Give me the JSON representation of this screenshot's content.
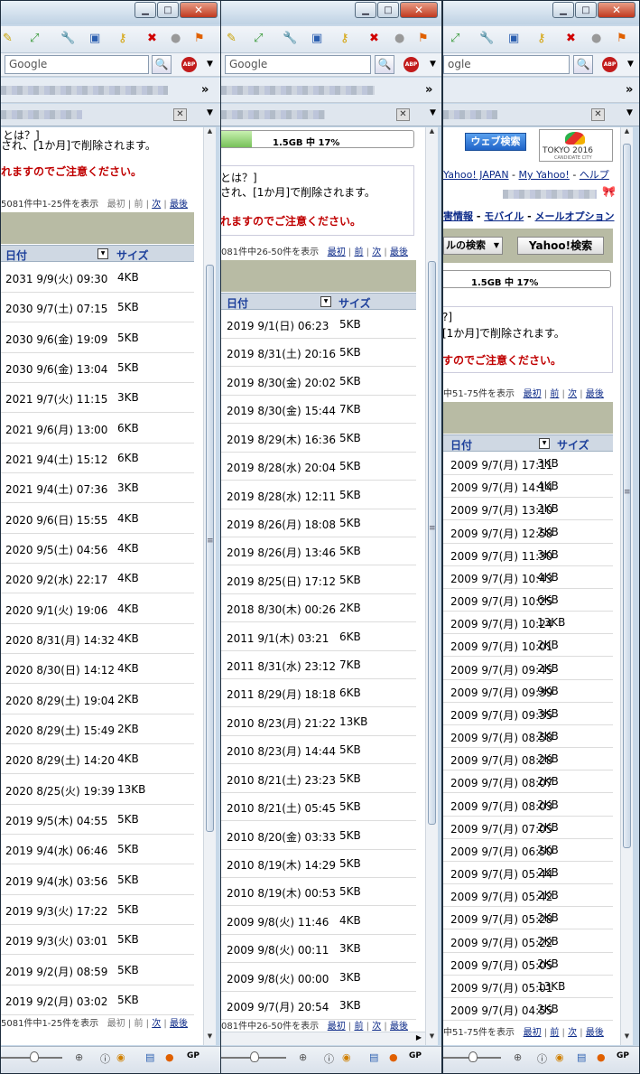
{
  "common": {
    "search_placeholder": "Google",
    "search_short": "ogle",
    "bm_chevron": "»",
    "quota_text": "1.5GB 中 17%",
    "quota_percent": 17,
    "col_date": "日付",
    "col_size": "サイズ",
    "nav_first": "最初",
    "nav_prev": "前",
    "nav_next": "次",
    "nav_last": "最後",
    "sep": "|"
  },
  "win1": {
    "notice_head": "とは？]",
    "notice_body": "され、[1か月]で削除されます。",
    "warning": "れますのでご注意ください。",
    "pager_count": "5081件中1-25件を表示",
    "rows": [
      {
        "date": "2031 9/9(火) 09:30",
        "size": "4KB"
      },
      {
        "date": "2030 9/7(土) 07:15",
        "size": "5KB"
      },
      {
        "date": "2030 9/6(金) 19:09",
        "size": "5KB"
      },
      {
        "date": "2030 9/6(金) 13:04",
        "size": "5KB"
      },
      {
        "date": "2021 9/7(火) 11:15",
        "size": "3KB"
      },
      {
        "date": "2021 9/6(月) 13:00",
        "size": "6KB"
      },
      {
        "date": "2021 9/4(土) 15:12",
        "size": "6KB"
      },
      {
        "date": "2021 9/4(土) 07:36",
        "size": "3KB"
      },
      {
        "date": "2020 9/6(日) 15:55",
        "size": "4KB"
      },
      {
        "date": "2020 9/5(土) 04:56",
        "size": "4KB"
      },
      {
        "date": "2020 9/2(水) 22:17",
        "size": "4KB"
      },
      {
        "date": "2020 9/1(火) 19:06",
        "size": "4KB"
      },
      {
        "date": "2020 8/31(月) 14:32",
        "size": "4KB"
      },
      {
        "date": "2020 8/30(日) 14:12",
        "size": "4KB"
      },
      {
        "date": "2020 8/29(土) 19:04",
        "size": "2KB"
      },
      {
        "date": "2020 8/29(土) 15:49",
        "size": "2KB"
      },
      {
        "date": "2020 8/29(土) 14:20",
        "size": "4KB"
      },
      {
        "date": "2020 8/25(火) 19:39",
        "size": "13KB"
      },
      {
        "date": "2019 9/5(木) 04:55",
        "size": "5KB"
      },
      {
        "date": "2019 9/4(水) 06:46",
        "size": "5KB"
      },
      {
        "date": "2019 9/4(水) 03:56",
        "size": "5KB"
      },
      {
        "date": "2019 9/3(火) 17:22",
        "size": "5KB"
      },
      {
        "date": "2019 9/3(火) 03:01",
        "size": "5KB"
      },
      {
        "date": "2019 9/2(月) 08:59",
        "size": "5KB"
      },
      {
        "date": "2019 9/2(月) 03:02",
        "size": "5KB"
      }
    ]
  },
  "win2": {
    "notice_head": "とは？]",
    "notice_body": "され、[1か月]で削除されます。",
    "warning": "れますのでご注意ください。",
    "pager_count": "081件中26-50件を表示",
    "rows": [
      {
        "date": "2019 9/1(日) 06:23",
        "size": "5KB"
      },
      {
        "date": "2019 8/31(土) 20:16",
        "size": "5KB"
      },
      {
        "date": "2019 8/30(金) 20:02",
        "size": "5KB"
      },
      {
        "date": "2019 8/30(金) 15:44",
        "size": "7KB"
      },
      {
        "date": "2019 8/29(木) 16:36",
        "size": "5KB"
      },
      {
        "date": "2019 8/28(水) 20:04",
        "size": "5KB"
      },
      {
        "date": "2019 8/28(水) 12:11",
        "size": "5KB"
      },
      {
        "date": "2019 8/26(月) 18:08",
        "size": "5KB"
      },
      {
        "date": "2019 8/26(月) 13:46",
        "size": "5KB"
      },
      {
        "date": "2019 8/25(日) 17:12",
        "size": "5KB"
      },
      {
        "date": "2018 8/30(木) 00:26",
        "size": "2KB"
      },
      {
        "date": "2011 9/1(木) 03:21",
        "size": "6KB"
      },
      {
        "date": "2011 8/31(水) 23:12",
        "size": "7KB"
      },
      {
        "date": "2011 8/29(月) 18:18",
        "size": "6KB"
      },
      {
        "date": "2010 8/23(月) 21:22",
        "size": "13KB"
      },
      {
        "date": "2010 8/23(月) 14:44",
        "size": "5KB"
      },
      {
        "date": "2010 8/21(土) 23:23",
        "size": "5KB"
      },
      {
        "date": "2010 8/21(土) 05:45",
        "size": "5KB"
      },
      {
        "date": "2010 8/20(金) 03:33",
        "size": "5KB"
      },
      {
        "date": "2010 8/19(木) 14:29",
        "size": "5KB"
      },
      {
        "date": "2010 8/19(木) 00:53",
        "size": "5KB"
      },
      {
        "date": "2009 9/8(火) 11:46",
        "size": "4KB"
      },
      {
        "date": "2009 9/8(火) 00:11",
        "size": "3KB"
      },
      {
        "date": "2009 9/8(火) 00:00",
        "size": "3KB"
      },
      {
        "date": "2009 9/7(月) 20:54",
        "size": "3KB"
      }
    ]
  },
  "win3": {
    "web_search": "ウェブ検索",
    "tokyo_logo": "TOKYO 2016",
    "tokyo_sub": "CANDIDATE CITY",
    "link_yahoo_japan": "Yahoo! JAPAN",
    "link_my_yahoo": "My Yahoo!",
    "link_help": "ヘルプ",
    "dash": "-",
    "link_info": "害情報",
    "link_mobile": "モバイル",
    "link_mail_option": "メールオプション",
    "search_in": "ルの検索",
    "yahoo_search": "Yahoo!検索",
    "notice_head": "?]",
    "notice_body": "[1か月]で削除されます。",
    "warning": "すのでご注意ください。",
    "pager_count": "中51-75件を表示",
    "pager_count_bottom": "中51-75件を表示",
    "rows": [
      {
        "date": "2009 9/7(月) 17:11",
        "size": "3KB"
      },
      {
        "date": "2009 9/7(月) 14:14",
        "size": "4KB"
      },
      {
        "date": "2009 9/7(月) 13:10",
        "size": "2KB"
      },
      {
        "date": "2009 9/7(月) 12:58",
        "size": "2KB"
      },
      {
        "date": "2009 9/7(月) 11:30",
        "size": "3KB"
      },
      {
        "date": "2009 9/7(月) 10:43",
        "size": "4KB"
      },
      {
        "date": "2009 9/7(月) 10:25",
        "size": "6KB"
      },
      {
        "date": "2009 9/7(月) 10:24",
        "size": "13KB"
      },
      {
        "date": "2009 9/7(月) 10:01",
        "size": "2KB"
      },
      {
        "date": "2009 9/7(月) 09:45",
        "size": "2KB"
      },
      {
        "date": "2009 9/7(月) 09:39",
        "size": "9KB"
      },
      {
        "date": "2009 9/7(月) 09:35",
        "size": "3KB"
      },
      {
        "date": "2009 9/7(月) 08:58",
        "size": "2KB"
      },
      {
        "date": "2009 9/7(月) 08:28",
        "size": "2KB"
      },
      {
        "date": "2009 9/7(月) 08:07",
        "size": "2KB"
      },
      {
        "date": "2009 9/7(月) 08:03",
        "size": "2KB"
      },
      {
        "date": "2009 9/7(月) 07:05",
        "size": "2KB"
      },
      {
        "date": "2009 9/7(月) 06:50",
        "size": "2KB"
      },
      {
        "date": "2009 9/7(月) 05:44",
        "size": "2KB"
      },
      {
        "date": "2009 9/7(月) 05:42",
        "size": "2KB"
      },
      {
        "date": "2009 9/7(月) 05:28",
        "size": "2KB"
      },
      {
        "date": "2009 9/7(月) 05:22",
        "size": "2KB"
      },
      {
        "date": "2009 9/7(月) 05:05",
        "size": "2KB"
      },
      {
        "date": "2009 9/7(月) 05:01",
        "size": "13KB"
      },
      {
        "date": "2009 9/7(月) 04:55",
        "size": "2KB"
      }
    ]
  }
}
